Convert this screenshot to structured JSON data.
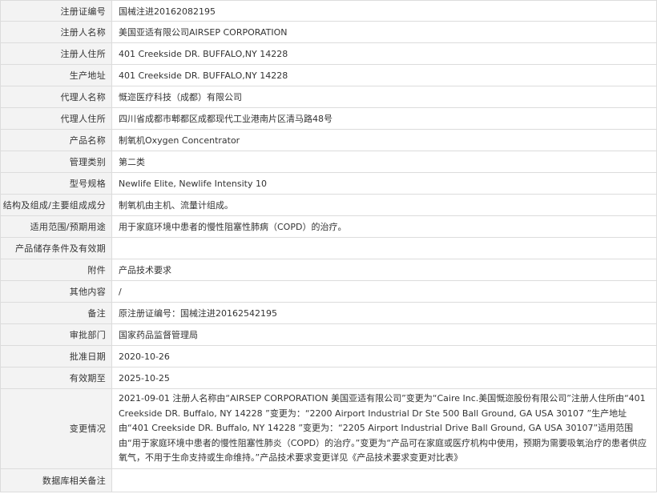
{
  "rows": [
    {
      "label": "注册证编号",
      "value": "国械注进20162082195"
    },
    {
      "label": "注册人名称",
      "value": "美国亚适有限公司AIRSEP CORPORATION"
    },
    {
      "label": "注册人住所",
      "value": "401 Creekside DR. BUFFALO,NY 14228"
    },
    {
      "label": "生产地址",
      "value": "401 Creekside DR. BUFFALO,NY 14228"
    },
    {
      "label": "代理人名称",
      "value": "慨迩医疗科技（成都）有限公司"
    },
    {
      "label": "代理人住所",
      "value": "四川省成都市郫都区成都现代工业港南片区清马路48号"
    },
    {
      "label": "产品名称",
      "value": "制氧机Oxygen Concentrator"
    },
    {
      "label": "管理类别",
      "value": "第二类"
    },
    {
      "label": "型号规格",
      "value": "Newlife Elite, Newlife Intensity 10"
    },
    {
      "label": "结构及组成/主要组成成分",
      "value": "制氧机由主机、流量计组成。"
    },
    {
      "label": "适用范围/预期用途",
      "value": "用于家庭环境中患者的慢性阻塞性肺病（COPD）的治疗。"
    },
    {
      "label": "产品储存条件及有效期",
      "value": ""
    },
    {
      "label": "附件",
      "value": "产品技术要求"
    },
    {
      "label": "其他内容",
      "value": "/"
    },
    {
      "label": "备注",
      "value": "原注册证编号：国械注进20162542195"
    },
    {
      "label": "审批部门",
      "value": "国家药品监督管理局"
    },
    {
      "label": "批准日期",
      "value": "2020-10-26"
    },
    {
      "label": "有效期至",
      "value": "2025-10-25"
    },
    {
      "label": "变更情况",
      "value": "2021-09-01 注册人名称由“AIRSEP CORPORATION 美国亚适有限公司”变更为“Caire Inc.美国慨迩股份有限公司”注册人住所由“401 Creekside DR. Buffalo, NY 14228 ”变更为：“2200 Airport Industrial Dr Ste 500 Ball Ground, GA USA 30107 ”生产地址由“401 Creekside DR. Buffalo, NY 14228 ”变更为：“2205 Airport Industrial Drive Ball Ground, GA USA 30107”适用范围由“用于家庭环境中患者的慢性阻塞性肺炎（COPD）的治疗。”变更为“产品可在家庭或医疗机构中使用，预期为需要吸氧治疗的患者供应氧气，不用于生命支持或生命维持。”产品技术要求变更详见《产品技术要求变更对比表》"
    },
    {
      "label": "数据库相关备注",
      "value": ""
    }
  ]
}
